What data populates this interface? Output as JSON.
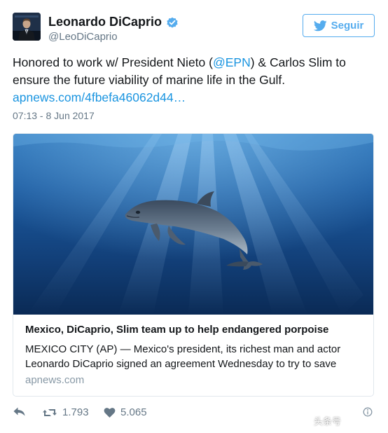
{
  "user": {
    "display_name": "Leonardo DiCaprio",
    "handle": "@LeoDiCaprio",
    "verified": true,
    "avatar_icon": "profile-photo"
  },
  "follow_button": {
    "label": "Seguir",
    "icon": "twitter-bird-icon",
    "color": "#55acee"
  },
  "tweet": {
    "text_before_mention": "Honored to work w/ President Nieto (",
    "mention": "@EPN",
    "text_after_mention": ") & Carlos Slim to ensure the future viability of marine life in the Gulf.",
    "link": "apnews.com/4fbefa46062d44…",
    "timestamp": "07:13 - 8 Jun 2017",
    "link_color": "#1b95e0"
  },
  "card": {
    "image_icon": "porpoise-underwater-photo",
    "title": "Mexico, DiCaprio, Slim team up to help endangered porpoise",
    "description": "MEXICO CITY (AP) — Mexico's president, its richest man and actor Leonardo DiCaprio signed an agreement Wednesday to try to save",
    "domain": "apnews.com"
  },
  "actions": {
    "reply_icon": "reply-icon",
    "retweet_icon": "retweet-icon",
    "retweet_count": "1.793",
    "like_icon": "heart-icon",
    "like_count": "5.065",
    "more_icon": "more-icon"
  },
  "watermark": {
    "text": "头条号"
  }
}
